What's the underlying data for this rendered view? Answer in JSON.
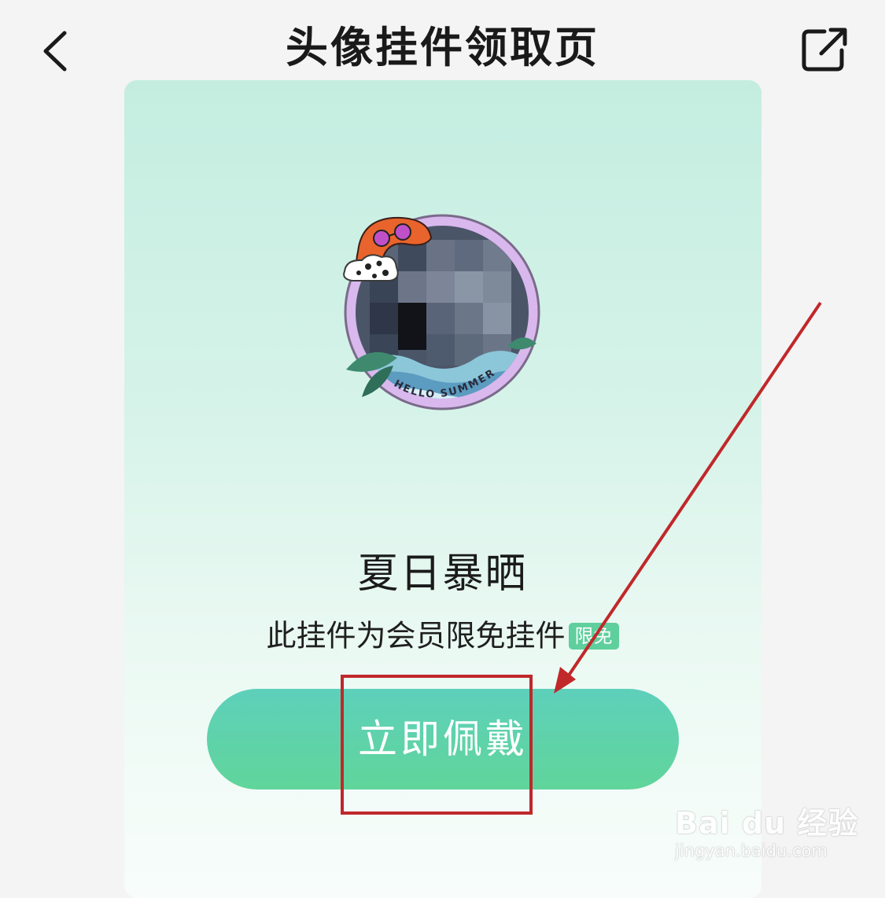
{
  "header": {
    "title": "头像挂件领取页",
    "back_icon": "chevron-left-icon",
    "share_icon": "share-external-icon"
  },
  "pendant": {
    "name": "夏日暴晒",
    "description": "此挂件为会员限免挂件",
    "badge": "限免",
    "frame_text": "HELLO SUMMER"
  },
  "action": {
    "wear_label": "立即佩戴"
  },
  "watermark": {
    "brand": "Bai du 经验",
    "url": "jingyan.baidu.com"
  },
  "colors": {
    "accent_green": "#60d59a",
    "annotation_red": "#c0282a",
    "frame_purple": "#d9b8ee"
  }
}
